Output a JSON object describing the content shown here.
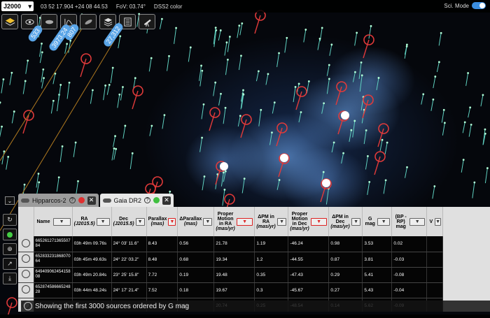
{
  "header": {
    "frame": "J2000",
    "coordinates": "03 52 17.904 +24 08 44.53",
    "fov": "FoV: 03.74°",
    "survey": "DSS2 color",
    "sci_mode_label": "Sci. Mode"
  },
  "toolbar": {
    "counts": [
      "533",
      "3973.24",
      "807",
      "27,312"
    ]
  },
  "tabs": [
    {
      "label": "Hipparcos-2",
      "dot_color": "#e03030"
    },
    {
      "label": "Gaia DR2",
      "dot_color": "#40c040"
    }
  ],
  "table": {
    "columns": [
      {
        "label": "Name",
        "unit": "",
        "filter_active": false
      },
      {
        "label": "RA",
        "unit": "(J2015.5)",
        "filter_active": false
      },
      {
        "label": "Dec",
        "unit": "(J2015.5)",
        "filter_active": false
      },
      {
        "label": "Parallax",
        "unit": "(mas)",
        "filter_active": true
      },
      {
        "label": "ΔParallax",
        "unit": "(mas)",
        "filter_active": false
      },
      {
        "label": "Proper Motion in RA",
        "unit": "(mas/yr)",
        "filter_active": true
      },
      {
        "label": "ΔPM in RA",
        "unit": "(mas/yr)",
        "filter_active": false
      },
      {
        "label": "Proper Motion in Dec",
        "unit": "(mas/yr)",
        "filter_active": true
      },
      {
        "label": "ΔPM in Dec",
        "unit": "(mas/yr)",
        "filter_active": false
      },
      {
        "label": "G mag",
        "unit": "",
        "filter_active": false
      },
      {
        "label": "(BP - RP) mag",
        "unit": "",
        "filter_active": false
      },
      {
        "label": "V",
        "unit": "",
        "filter_active": false
      }
    ],
    "rows": [
      [
        "665261271365507 84",
        "03h 49m 09.76s",
        "24° 03' 11.6\"",
        "8.43",
        "0.56",
        "21.78",
        "1.19",
        "-46.24",
        "0.98",
        "3.53",
        "0.02"
      ],
      [
        "652833231868070 64",
        "03h 45m 49.63s",
        "24° 22' 03.2\"",
        "8.48",
        "0.68",
        "19.34",
        "1.2",
        "-44.55",
        "0.87",
        "3.81",
        "-0.03"
      ],
      [
        "649409062454158 08",
        "03h 49m 20.84s",
        "23° 25' 15.8\"",
        "7.72",
        "0.19",
        "19.48",
        "0.35",
        "-47.43",
        "0.29",
        "5.41",
        "-0.08"
      ],
      [
        "652874586665248 28",
        "03h 44m 48.24s",
        "24° 17' 21.4\"",
        "7.52",
        "0.18",
        "19.67",
        "0.3",
        "-45.67",
        "0.27",
        "5.43",
        "-0.04"
      ],
      [
        "",
        "",
        "",
        "",
        "0.12",
        "20.74",
        "0.25",
        "-48.54",
        "0.14",
        "5.62",
        "-0.09"
      ]
    ],
    "footer": "Showing the first 3000 sources ordered by G mag"
  }
}
